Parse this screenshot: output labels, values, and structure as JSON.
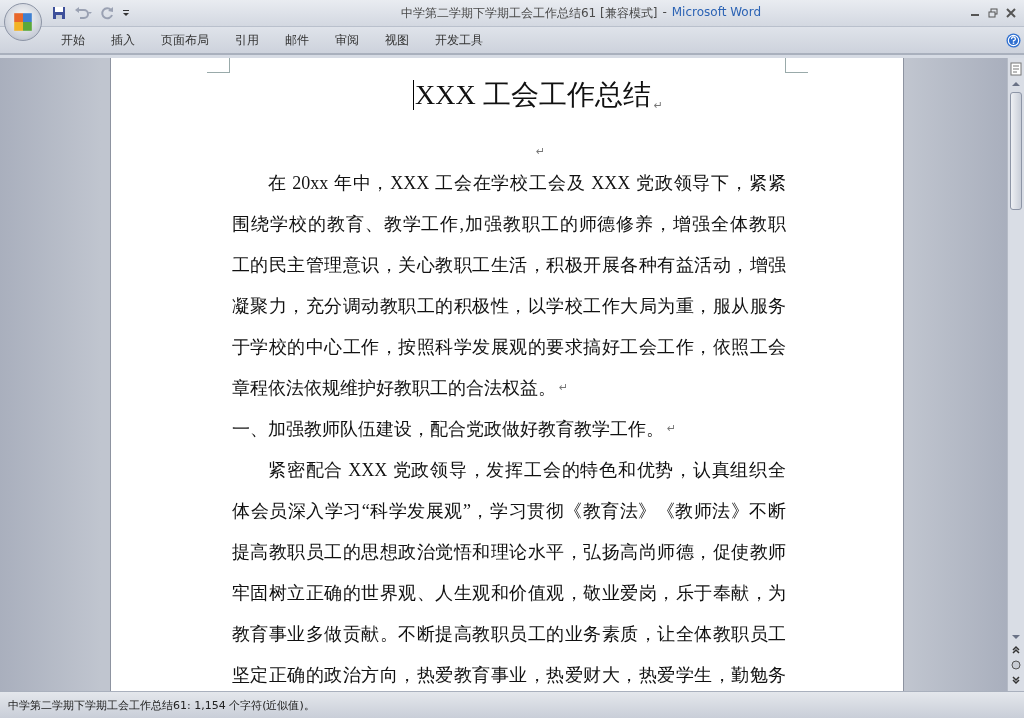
{
  "window": {
    "document": "中学第二学期下学期工会工作总结61 [兼容模式]",
    "separator": "-",
    "app": "Microsoft Word"
  },
  "ribbon_tabs": [
    {
      "label": "开始",
      "selected": false
    },
    {
      "label": "插入",
      "selected": false
    },
    {
      "label": "页面布局",
      "selected": false
    },
    {
      "label": "引用",
      "selected": false
    },
    {
      "label": "邮件",
      "selected": false
    },
    {
      "label": "审阅",
      "selected": false
    },
    {
      "label": "视图",
      "selected": false
    },
    {
      "label": "开发工具",
      "selected": false
    }
  ],
  "paragraphs": [
    {
      "kind": "title",
      "lines": [
        "XXX 工会工作总结"
      ],
      "mark": "↵"
    },
    {
      "kind": "blank",
      "mark": "↵"
    },
    {
      "kind": "body",
      "lines": [
        "在 20xx 年中，XXX 工会在学校工会及 XXX 党政领导下，紧紧",
        "围绕学校的教育、教学工作,加强教职工的师德修养，增强全体教职",
        "工的民主管理意识，关心教职工生活，积极开展各种有益活动，增强",
        "凝聚力，充分调动教职工的积极性，以学校工作大局为重，服从服务",
        "于学校的中心工作，按照科学发展观的要求搞好工会工作，依照工会",
        "章程依法依规维护好教职工的合法权益。"
      ],
      "mark": "↵"
    },
    {
      "kind": "heading",
      "lines": [
        "一、加强教师队伍建设，配合党政做好教育教学工作。"
      ],
      "mark": "↵"
    },
    {
      "kind": "body",
      "lines": [
        "紧密配合 XXX 党政领导，发挥工会的特色和优势，认真组织全",
        "体会员深入学习“科学发展观”，学习贯彻《教育法》《教师法》不断",
        "提高教职员工的思想政治觉悟和理论水平，弘扬高尚师德，促使教师",
        "牢固树立正确的世界观、人生观和价值观，敬业爱岗，乐于奉献，为",
        "教育事业多做贡献。不断提高教职员工的业务素质，让全体教职员工",
        "坚定正确的政治方向，热爱教育事业，热爱财大，热爱学生，勤勉务"
      ]
    }
  ],
  "status_bar": "中学第二学期下学期工会工作总结61: 1,154 个字符(近似值)。"
}
